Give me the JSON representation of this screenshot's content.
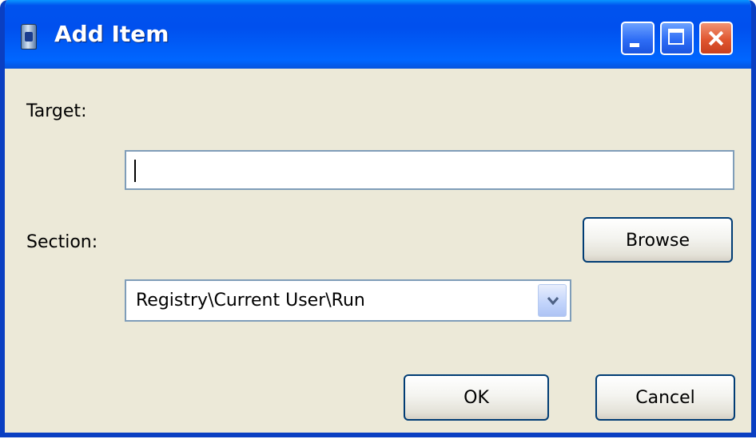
{
  "window": {
    "title": "Add Item",
    "icon": "app-icon"
  },
  "titlebar": {
    "minimize_icon": "minimize-icon",
    "maximize_icon": "maximize-icon",
    "close_icon": "close-icon"
  },
  "form": {
    "target_label": "Target:",
    "target_value": "",
    "section_label": "Section:",
    "section_value": "Registry\\Current User\\Run",
    "dropdown_icon": "chevron-down-icon"
  },
  "buttons": {
    "browse": "Browse",
    "ok": "OK",
    "cancel": "Cancel"
  },
  "colors": {
    "titlebar_blue": "#0053ee",
    "close_red": "#e0562f",
    "dialog_bg": "#ece9d8",
    "field_border": "#7f9db9"
  }
}
